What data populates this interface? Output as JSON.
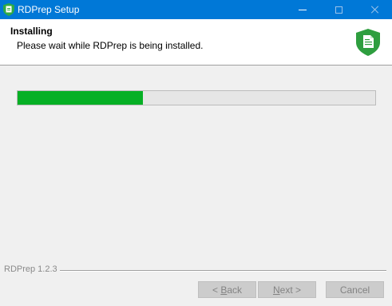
{
  "window": {
    "title": "RDPrep Setup"
  },
  "header": {
    "title": "Installing",
    "subtitle": "Please wait while RDPrep is being installed.",
    "icon": "green-shield-document-icon"
  },
  "progress": {
    "value_percent": 35,
    "color": "#06b025"
  },
  "footer": {
    "brand": "RDPrep 1.2.3",
    "back_mnemonic": "B",
    "back_rest": "ack",
    "back_prefix": "< ",
    "next_mnemonic": "N",
    "next_rest": "ext >",
    "cancel_label": "Cancel"
  },
  "colors": {
    "titlebar": "#0078d7",
    "accent_green": "#06b025",
    "shield_green": "#2e9e3f"
  }
}
